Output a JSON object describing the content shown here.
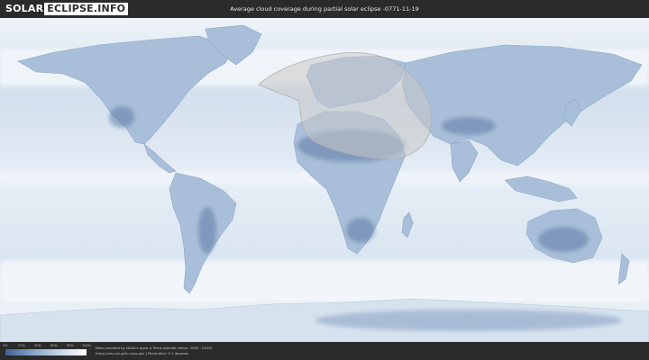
{
  "header": {
    "logo_solar": "SOLAR",
    "logo_eclipse": "ECLIPSE.INFO",
    "title": "Average cloud coverage during partial solar eclipse -0771-11-19"
  },
  "map": {
    "ocean_color": "#dde8f2",
    "land_color": "#9fb6d3",
    "eclipse_overlay_color": "#c9c9c9"
  },
  "legend": {
    "ticks": [
      "0%",
      "20%",
      "40%",
      "60%",
      "80%",
      "100%"
    ],
    "colors": [
      "#3f5f8f",
      "#7f9dc2",
      "#c2d3e5",
      "#ffffff"
    ]
  },
  "footer": {
    "credit_line1": "Data provided by NASA's Aqua & Terra satellite (Years: 2000 - 2019)",
    "credit_line2": "https://neo.sci.gsfc.nasa.gov | Resolution: 0.1 degrees"
  }
}
